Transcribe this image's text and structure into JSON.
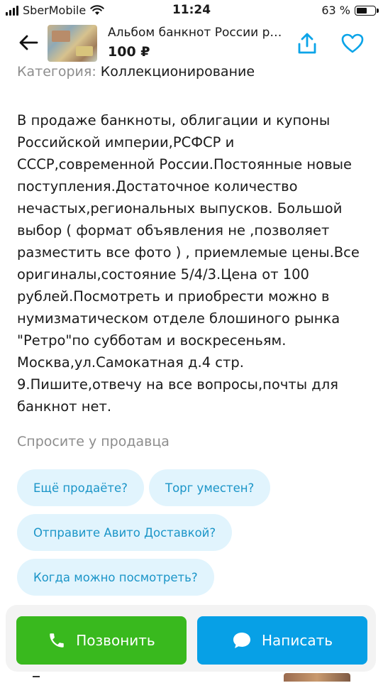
{
  "status_bar": {
    "carrier": "SberMobile",
    "time": "11:24",
    "battery": "63 %",
    "battery_level": 0.63
  },
  "header": {
    "title": "Альбом банкнот России раз...",
    "price": "100 ₽",
    "icons": {
      "back": "arrow-left",
      "share": "share-upload",
      "favorite": "heart-outline"
    },
    "accent_color": "#0aa4e8"
  },
  "category": {
    "label": "Категория:",
    "value": "Коллекционирование"
  },
  "description": "В продаже банкноты, облигации и купоны Российской империи,РСФСР и СССР,современной России.Постоянные новые поступления.Достаточное количество нечастых,региональных выпусков. Большой выбор ( формат объявления не ,позволяет разместить все фото ) , приемлемые цены.Все оригиналы,состояние 5/4/3.Цена от 100 рублей.Посмотреть и приобрести можно в нумизматическом отделе блошиного рынка \"Ретро\"по субботам и воскресеньям. Москва,ул.Самокатная д.4 стр. 9.Пишите,отвечу на все вопросы,почты для банкнот нет.",
  "ask_seller": {
    "title": "Спросите у продавца",
    "chips": [
      "Ещё продаёте?",
      "Торг уместен?",
      "Отправите Авито Доставкой?",
      "Когда можно посмотреть?"
    ],
    "chip_bg": "#e1f4fd",
    "chip_text": "#1b95c8"
  },
  "actions": {
    "call_label": "Позвонить",
    "call_icon": "phone-icon",
    "call_color": "#39b91e",
    "write_label": "Написать",
    "write_icon": "chat-bubble-icon",
    "write_color": "#07a0e6"
  }
}
